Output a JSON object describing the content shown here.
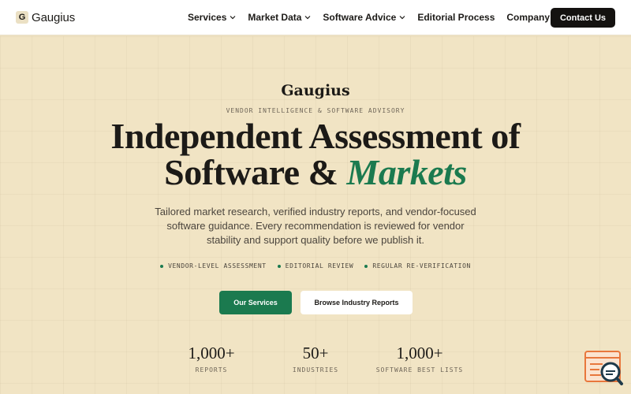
{
  "header": {
    "logo_letter": "G",
    "logo_text": "Gaugius",
    "nav": [
      {
        "label": "Services",
        "dropdown": true
      },
      {
        "label": "Market Data",
        "dropdown": true
      },
      {
        "label": "Software Advice",
        "dropdown": true
      },
      {
        "label": "Editorial Process",
        "dropdown": false
      },
      {
        "label": "Company",
        "dropdown": true
      }
    ],
    "contact_label": "Contact Us"
  },
  "hero": {
    "brand": "Gaugius",
    "eyebrow": "VENDOR INTELLIGENCE & SOFTWARE ADVISORY",
    "headline_line1": "Independent Assessment of",
    "headline_line2_plain": "Software & ",
    "headline_line2_accent": "Markets",
    "subtext": "Tailored market research, verified industry reports, and vendor-focused software guidance. Every recommendation is reviewed for vendor stability and support quality before we publish it.",
    "features": [
      "VENDOR-LEVEL ASSESSMENT",
      "EDITORIAL REVIEW",
      "REGULAR RE-VERIFICATION"
    ],
    "cta_primary": "Our Services",
    "cta_secondary": "Browse Industry Reports"
  },
  "stats": [
    {
      "value": "1,000+",
      "label": "REPORTS"
    },
    {
      "value": "50+",
      "label": "INDUSTRIES"
    },
    {
      "value": "1,000+",
      "label": "SOFTWARE BEST LISTS"
    }
  ],
  "widget": {
    "icon": "search-chat-icon"
  },
  "colors": {
    "background": "#f1e4c4",
    "accent": "#1b7a4f",
    "dark": "#141210",
    "widget": "#e8773c"
  }
}
